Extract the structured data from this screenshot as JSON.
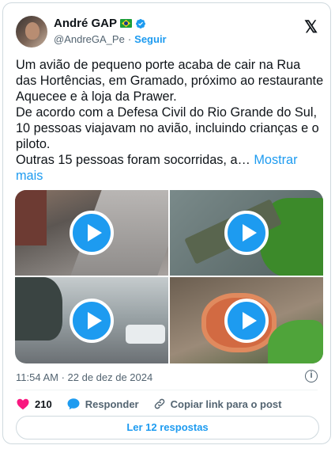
{
  "author": {
    "name": "André GAP",
    "handle": "@AndreGA_Pe",
    "separator": "·",
    "follow_label": "Seguir"
  },
  "brand_logo": "𝕏",
  "tweet": {
    "paragraph_1": "Um avião de pequeno porte acaba de cair na Rua das Hortências, em Gramado, próximo ao restaurante Aquecee e à loja da Prawer.",
    "paragraph_2": "De acordo com a Defesa Civil do Rio Grande do Sul, 10 pessoas viajavam no avião, incluindo crianças e o piloto.",
    "paragraph_3": "Outras 15 pessoas foram socorridas, a…",
    "show_more": "Mostrar mais"
  },
  "timestamp": "11:54 AM · 22 de dez de 2024",
  "actions": {
    "likes": "210",
    "reply_label": "Responder",
    "copy_label": "Copiar link para o post"
  },
  "read_replies": "Ler 12 respostas",
  "colors": {
    "accent": "#1d9bf0",
    "like": "#f91880",
    "text": "#0f1419",
    "muted": "#536471"
  }
}
